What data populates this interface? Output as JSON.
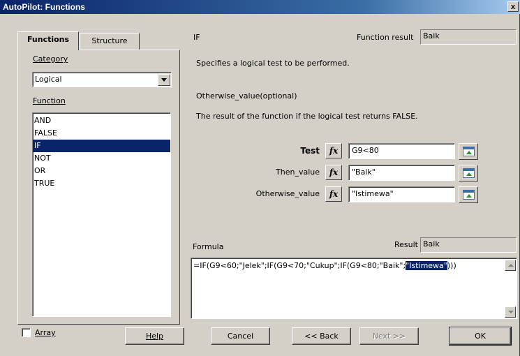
{
  "window": {
    "title": "AutoPilot: Functions",
    "close_label": "x"
  },
  "tabs": [
    {
      "label": "Functions"
    },
    {
      "label": "Structure"
    }
  ],
  "category": {
    "label": "Category",
    "value": "Logical"
  },
  "function_list": {
    "label": "Function",
    "items": [
      "AND",
      "FALSE",
      "IF",
      "NOT",
      "OR",
      "TRUE"
    ],
    "selected": "IF"
  },
  "function": {
    "name": "IF",
    "result_label": "Function result",
    "result_value": "Baik",
    "description": "Specifies a logical test to be performed.",
    "param_name": "Otherwise_value(optional)",
    "param_description": "The result of the function if the logical test returns FALSE."
  },
  "params": [
    {
      "label": "Test",
      "value": "G9<80",
      "fx": "fx"
    },
    {
      "label": "Then_value",
      "value": "\"Baik\"",
      "fx": "fx"
    },
    {
      "label": "Otherwise_value",
      "value": "\"Istimewa\"",
      "fx": "fx"
    }
  ],
  "formula": {
    "label": "Formula",
    "result_label": "Result",
    "result_value": "Baik",
    "prefix": "=IF(G9<60;\"Jelek\";IF(G9<70;\"Cukup\";IF(G9<80;\"Baik\";",
    "highlight": "\"Istimewa\"",
    "suffix": ")))"
  },
  "array_label": "Array",
  "buttons": {
    "help": "Help",
    "cancel": "Cancel",
    "back": "<< Back",
    "next": "Next >>",
    "ok": "OK"
  },
  "colors": {
    "title_bar": "#0a246a",
    "dialog_bg": "#d4d0c8",
    "selection": "#0a246a"
  }
}
